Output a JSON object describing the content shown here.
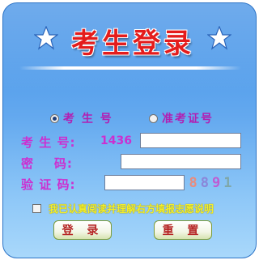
{
  "title": "考生登录",
  "login_type": {
    "options": [
      {
        "label": "考 生 号",
        "selected": true
      },
      {
        "label": "准考证号",
        "selected": false
      }
    ]
  },
  "fields": {
    "exam_no": {
      "label": "考 生 号:",
      "prefix": "1436",
      "value": ""
    },
    "password": {
      "label": "密    码:",
      "value": ""
    },
    "captcha": {
      "label": "验 证 码:",
      "value": "",
      "code": [
        "8",
        "8",
        "9",
        "1"
      ]
    }
  },
  "agreement": {
    "text": "我已认真阅读并理解右方填报志愿说明",
    "checked": false
  },
  "buttons": {
    "login": "登 录",
    "reset": "重 置"
  },
  "colors": {
    "panel": "#64a9ef",
    "title": "#e41c1c",
    "label": "#cc2fd0",
    "agreement": "#f4ef2a"
  },
  "icons": [
    "star-icon",
    "star-icon"
  ]
}
